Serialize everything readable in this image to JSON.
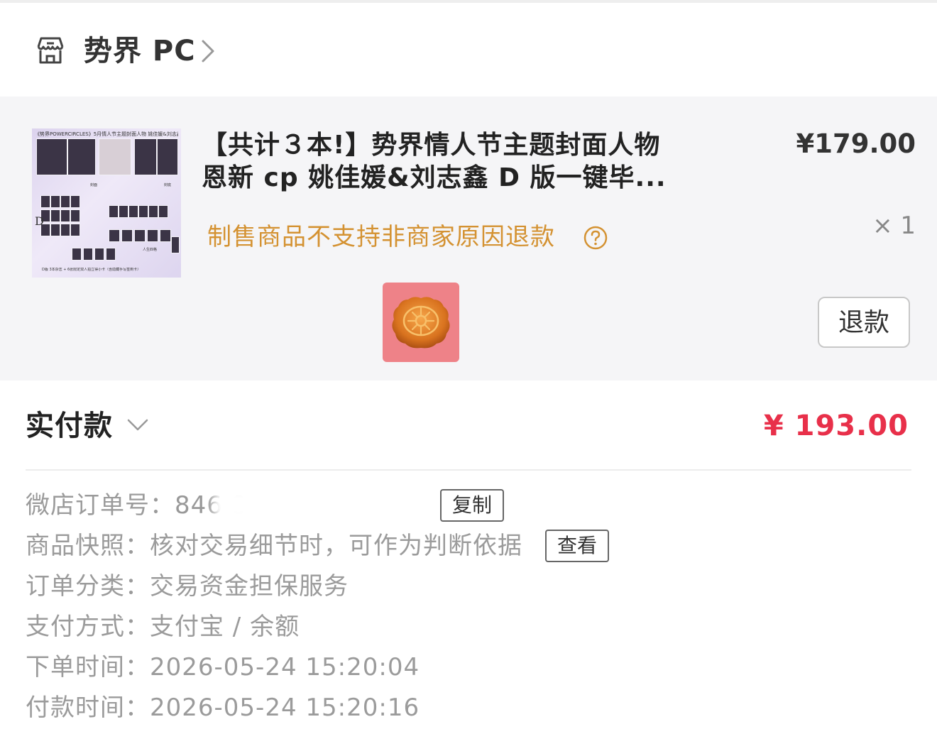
{
  "shop": {
    "name": "势界 PC",
    "icon": "store-icon",
    "chevron": "chevron-right-icon"
  },
  "product": {
    "thumbnail_caption": "《势界POWERCIRCLES》5月情人节主题封面人物 姚佳媛&刘志鑫",
    "thumbnail_text": {
      "cover": "封面",
      "back_cover": "封底",
      "version": "D",
      "card_shots": "人生四格",
      "bottom_note": "D版 3本杂志 + 6张限定双人拍立得小卡（含隐藏手写签到卡）"
    },
    "title": "【共计３本!】势界情人节主题封面人物恩新 cp 姚佳媛&刘志鑫  D 版一键毕...",
    "price": "¥179.00",
    "quantity": "× 1",
    "return_note": "制售商品不支持非商家原因退款",
    "help_icon": "help-circle-icon",
    "emoji": "mooncake-icon",
    "refund_label": "退款"
  },
  "payment": {
    "label": "实付款",
    "amount": "¥ 193.00",
    "expand_icon": "chevron-down-icon"
  },
  "order": {
    "order_no": {
      "label": "微店订单号：",
      "value": "846                          8",
      "button": "复制"
    },
    "snapshot": {
      "label": "商品快照：",
      "value": "核对交易细节时，可作为判断依据",
      "button": "查看"
    },
    "category": {
      "label": "订单分类：",
      "value": "交易资金担保服务"
    },
    "pay_method": {
      "label": "支付方式：",
      "value": "支付宝 / 余额"
    },
    "order_time": {
      "label": "下单时间：",
      "value": "2026-05-24 15:20:04"
    },
    "pay_time": {
      "label": "付款时间：",
      "value": "2026-05-24 15:20:16"
    }
  },
  "colors": {
    "accent_red": "#e8304a",
    "note_orange": "#d49232",
    "emoji_tile": "#ee8288",
    "section_bg": "#f5f5f7"
  }
}
